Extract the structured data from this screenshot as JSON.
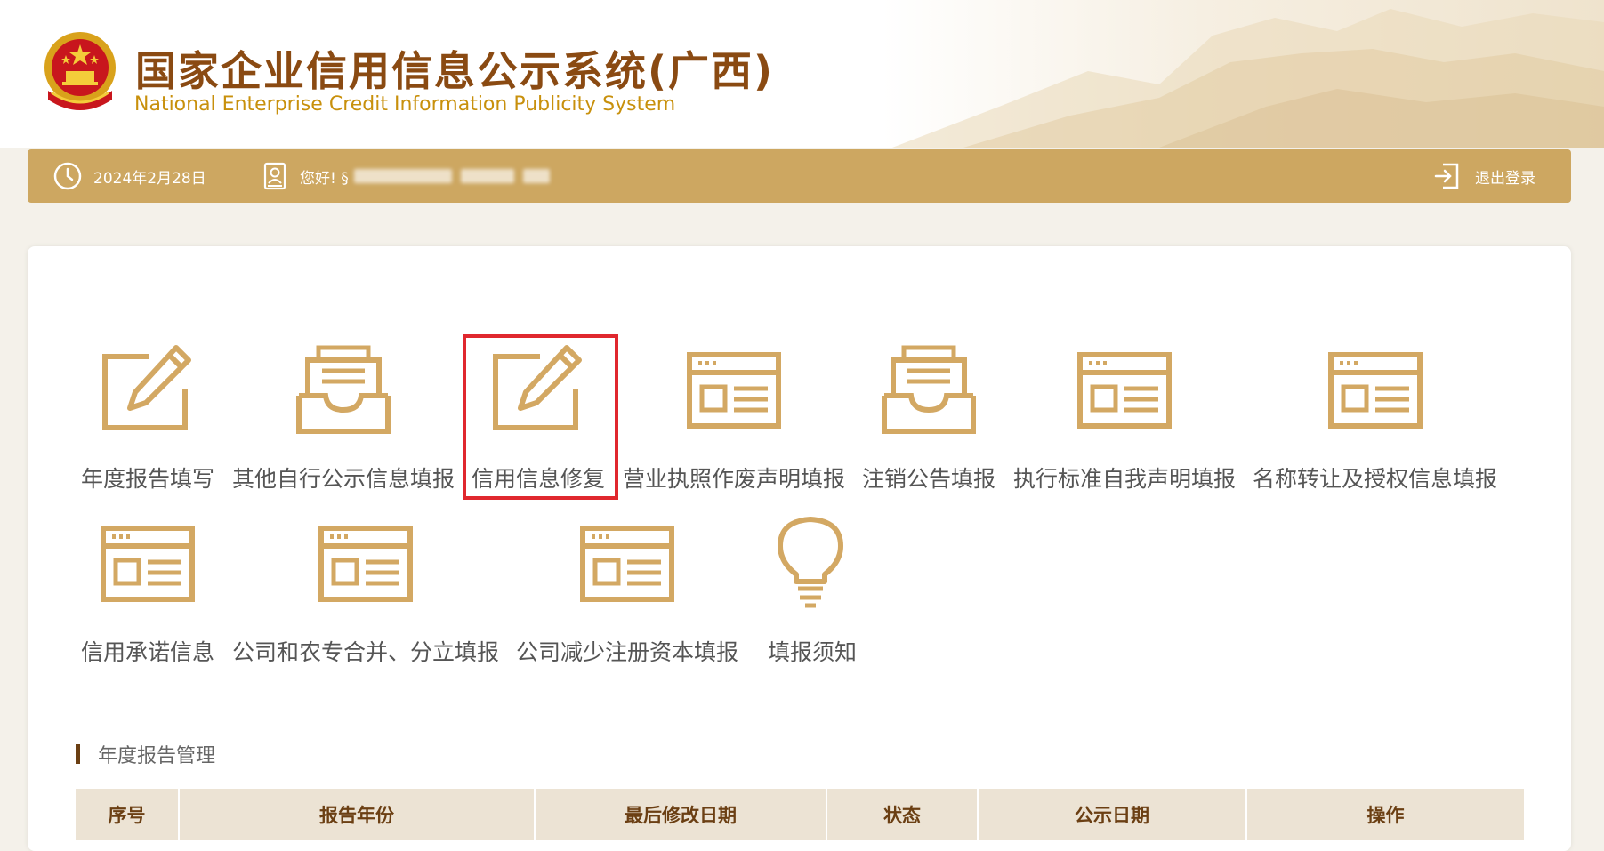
{
  "header": {
    "title_cn": "国家企业信用信息公示系统(广西)",
    "title_en": "National Enterprise Credit Information Publicity System"
  },
  "topbar": {
    "date": "2024年2月28日",
    "greeting": "您好! §",
    "logout_label": "退出登录"
  },
  "tiles": [
    {
      "label": "年度报告填写",
      "icon": "edit-icon"
    },
    {
      "label": "其他自行公示信息填报",
      "icon": "inbox-icon"
    },
    {
      "label": "信用信息修复",
      "icon": "edit-icon",
      "highlighted": true
    },
    {
      "label": "营业执照作废声明填报",
      "icon": "browser-window-icon"
    },
    {
      "label": "注销公告填报",
      "icon": "inbox-icon"
    },
    {
      "label": "执行标准自我声明填报",
      "icon": "browser-window-icon"
    },
    {
      "label": "名称转让及授权信息填报",
      "icon": "browser-window-icon"
    },
    {
      "label": "信用承诺信息",
      "icon": "browser-window-icon"
    },
    {
      "label": "公司和农专合并、分立填报",
      "icon": "browser-window-icon"
    },
    {
      "label": "公司减少注册资本填报",
      "icon": "browser-window-icon"
    },
    {
      "label": "填报须知",
      "icon": "lightbulb-icon"
    }
  ],
  "section": {
    "title": "年度报告管理"
  },
  "table": {
    "columns": [
      "序号",
      "报告年份",
      "最后修改日期",
      "状态",
      "公示日期",
      "操作"
    ]
  },
  "colors": {
    "accent": "#cda761",
    "icon_gold": "#d3a863",
    "title_brown": "#8a4a12",
    "highlight_red": "#e0282e"
  }
}
